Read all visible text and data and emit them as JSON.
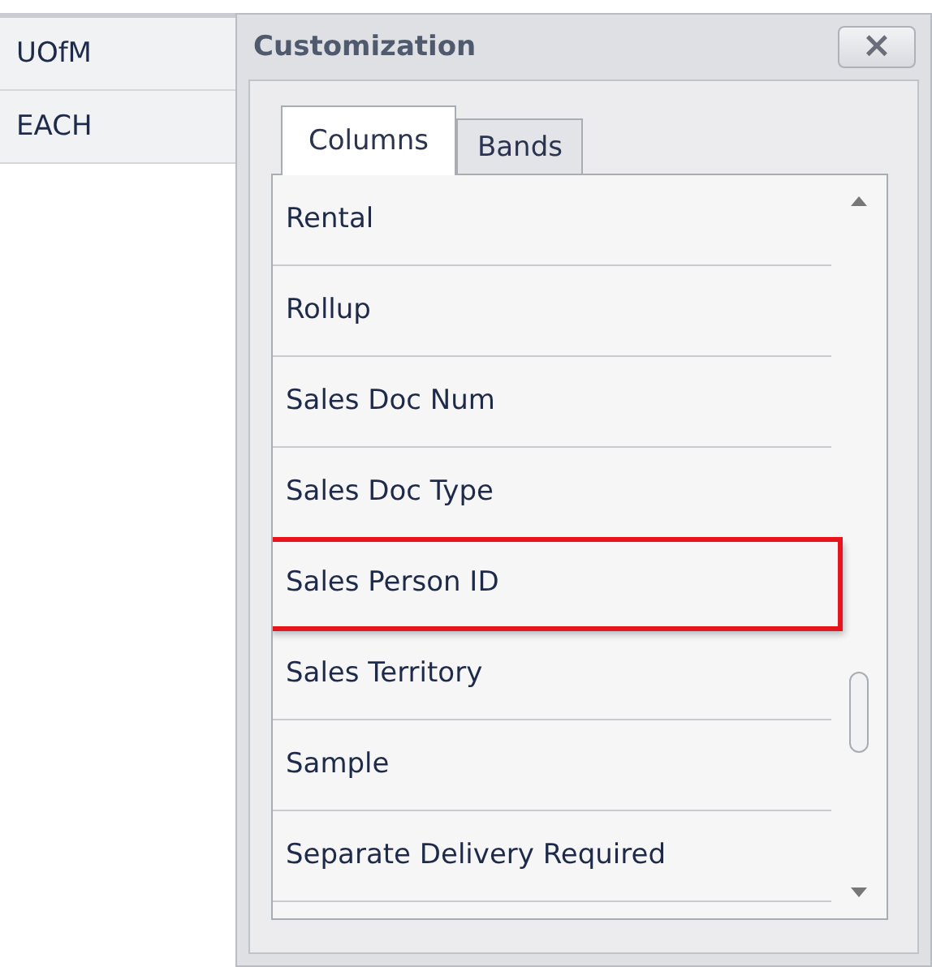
{
  "grid": {
    "column": "UOfM",
    "rows": [
      "EACH"
    ]
  },
  "customization": {
    "title": "Customization",
    "close": "×",
    "tabs": [
      {
        "label": "Columns",
        "selected": true
      },
      {
        "label": "Bands",
        "selected": false
      }
    ],
    "items": [
      {
        "label": "Rental",
        "highlighted": false
      },
      {
        "label": "Rollup",
        "highlighted": false
      },
      {
        "label": "Sales Doc Num",
        "highlighted": false
      },
      {
        "label": "Sales Doc Type",
        "highlighted": false
      },
      {
        "label": "Sales Person ID",
        "highlighted": true
      },
      {
        "label": "Sales Territory",
        "highlighted": false
      },
      {
        "label": "Sample",
        "highlighted": false
      },
      {
        "label": "Separate Delivery Required",
        "highlighted": false
      }
    ]
  }
}
